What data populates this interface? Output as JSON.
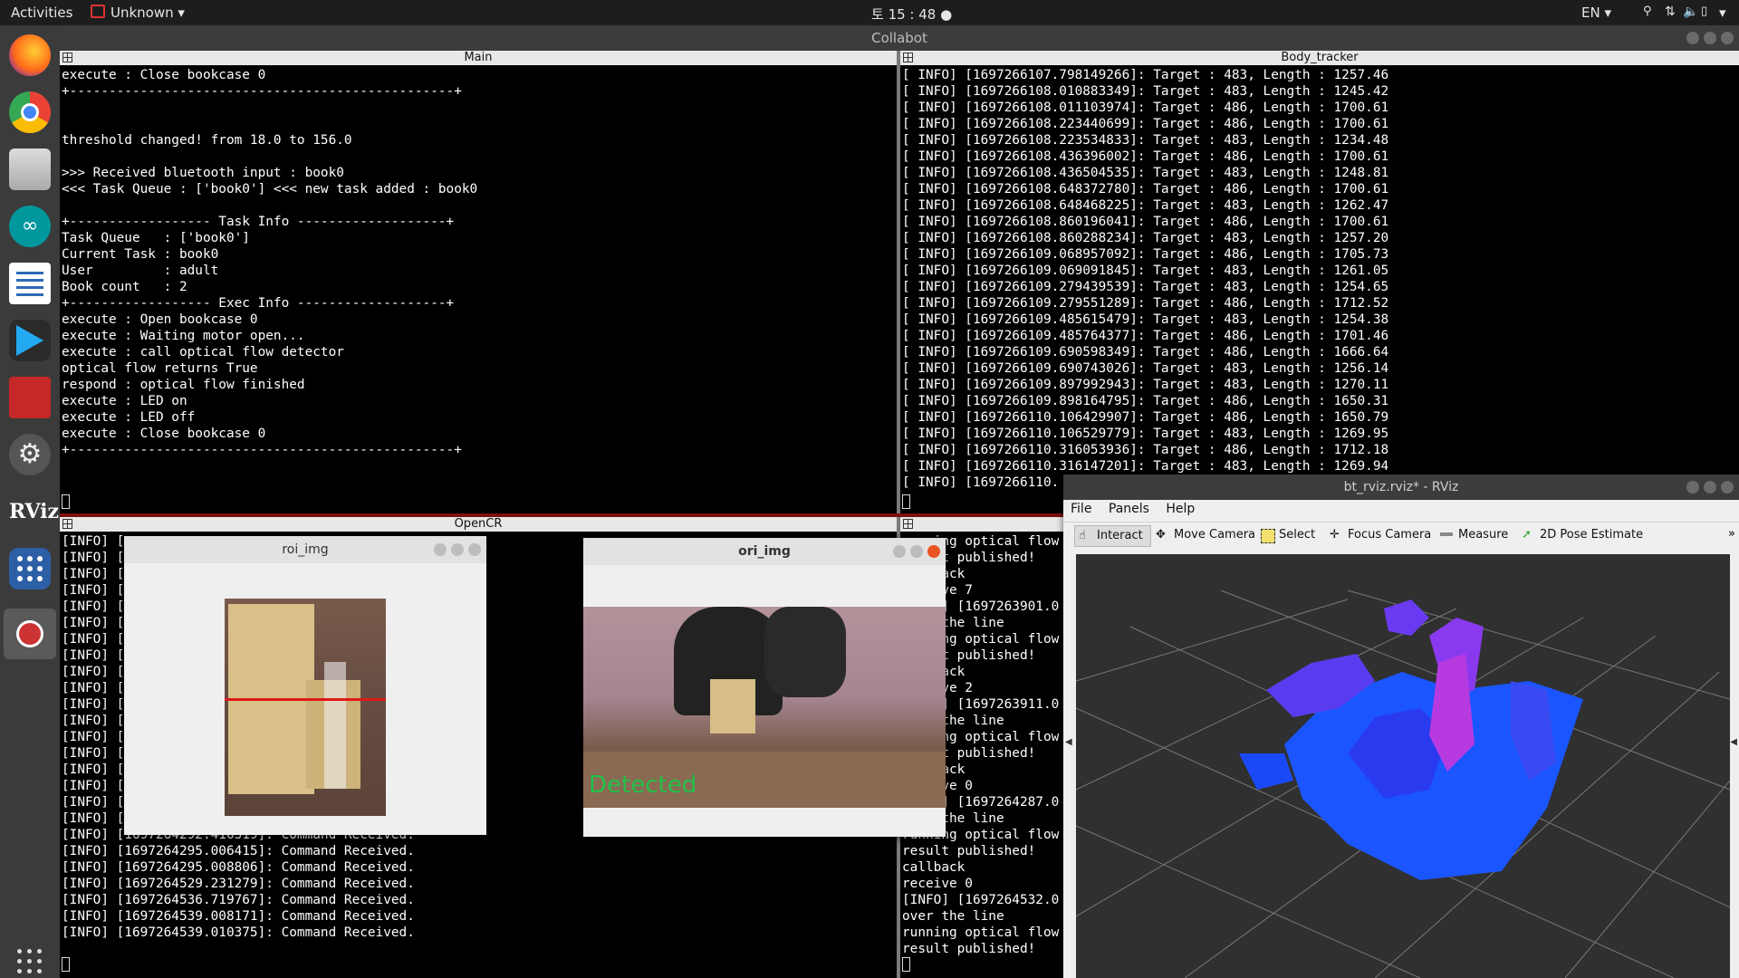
{
  "topbar": {
    "activities": "Activities",
    "app_menu": "Unknown",
    "clock": "토 15 : 48",
    "lang": "EN"
  },
  "terminator": {
    "title": "Collabot"
  },
  "dock": {
    "icons": [
      "firefox-icon",
      "chrome-icon",
      "files-icon",
      "arduino-icon",
      "text-editor-icon",
      "vscode-icon",
      "system-monitor-icon",
      "settings-icon",
      "rviz-icon",
      "app-grid-icon",
      "recorder-icon",
      "show-apps-icon"
    ],
    "rviz_label": "RViz"
  },
  "panes": {
    "main": {
      "title": "Main",
      "text": "execute : Close bookcase 0\n+-------------------------------------------------+\n\n\nthreshold changed! from 18.0 to 156.0\n\n>>> Received bluetooth input : book0\n<<< Task Queue : ['book0'] <<< new task added : book0\n\n+------------------ Task Info -------------------+\nTask Queue   : ['book0']\nCurrent Task : book0\nUser         : adult\nBook count   : 2\n+------------------ Exec Info -------------------+\nexecute : Open bookcase 0\nexecute : Waiting motor open...\nexecute : call optical flow detector\noptical flow returns True\nrespond : optical flow finished\nexecute : LED on\nexecute : LED off\nexecute : Close bookcase 0\n+-------------------------------------------------+"
    },
    "body_tracker": {
      "title": "Body_tracker",
      "text": "[ INFO] [1697266107.798149266]: Target : 483, Length : 1257.46\n[ INFO] [1697266108.010883349]: Target : 483, Length : 1245.42\n[ INFO] [1697266108.011103974]: Target : 486, Length : 1700.61\n[ INFO] [1697266108.223440699]: Target : 486, Length : 1700.61\n[ INFO] [1697266108.223534833]: Target : 483, Length : 1234.48\n[ INFO] [1697266108.436396002]: Target : 486, Length : 1700.61\n[ INFO] [1697266108.436504535]: Target : 483, Length : 1248.81\n[ INFO] [1697266108.648372780]: Target : 486, Length : 1700.61\n[ INFO] [1697266108.648468225]: Target : 483, Length : 1262.47\n[ INFO] [1697266108.860196041]: Target : 486, Length : 1700.61\n[ INFO] [1697266108.860288234]: Target : 483, Length : 1257.20\n[ INFO] [1697266109.068957092]: Target : 486, Length : 1705.73\n[ INFO] [1697266109.069091845]: Target : 483, Length : 1261.05\n[ INFO] [1697266109.279439539]: Target : 483, Length : 1254.65\n[ INFO] [1697266109.279551289]: Target : 486, Length : 1712.52\n[ INFO] [1697266109.485615479]: Target : 483, Length : 1254.38\n[ INFO] [1697266109.485764377]: Target : 486, Length : 1701.46\n[ INFO] [1697266109.690598349]: Target : 486, Length : 1666.64\n[ INFO] [1697266109.690743026]: Target : 483, Length : 1256.14\n[ INFO] [1697266109.897992943]: Target : 483, Length : 1270.11\n[ INFO] [1697266109.898164795]: Target : 486, Length : 1650.31\n[ INFO] [1697266110.106429907]: Target : 486, Length : 1650.79\n[ INFO] [1697266110.106529779]: Target : 483, Length : 1269.95\n[ INFO] [1697266110.316053936]: Target : 486, Length : 1712.18\n[ INFO] [1697266110.316147201]: Target : 483, Length : 1269.94\n[ INFO] [1697266110."
    },
    "opencr": {
      "title": "OpenCR",
      "text": "[INFO] [\n[INFO] [\n[INFO] [\n[INFO] [\n[INFO] [\n[INFO] [\n[INFO] [\n[INFO] [\n[INFO] [\n[INFO] [\n[INFO] [\n[INFO] [\n[INFO] [\n[INFO] [\n[INFO] [\n[INFO] [\n[INFO] [\n[INFO] [1697264284.655955]: Command Received.\n[INFO] [1697264292.416319]: Command Received.\n[INFO] [1697264295.006415]: Command Received.\n[INFO] [1697264295.008806]: Command Received.\n[INFO] [1697264529.231279]: Command Received.\n[INFO] [1697264536.719767]: Command Received.\n[INFO] [1697264539.008171]: Command Received.\n[INFO] [1697264539.010375]: Command Received."
    },
    "fourth": {
      "title": "",
      "text": "running optical flow\nresult published!\ncallback\nreceive 7\n[INFO] [1697263901.0\nover the line\nrunning optical flow\nresult published!\ncallback\nreceive 2\n[INFO] [1697263911.0\nover the line\nrunning optical flow\nresult published!\ncallback\nreceive 0\n[INFO] [1697264287.0\nover the line\nrunning optical flow\nresult published!\ncallback\nreceive 0\n[INFO] [1697264532.0\nover the line\nrunning optical flow\nresult published!"
    }
  },
  "roi_window": {
    "title": "roi_img"
  },
  "ori_window": {
    "title": "ori_img",
    "overlay_text": "Detected"
  },
  "rviz": {
    "title": "bt_rviz.rviz* - RViz",
    "menu": {
      "file": "File",
      "panels": "Panels",
      "help": "Help"
    },
    "toolbar": {
      "interact": "Interact",
      "move_camera": "Move Camera",
      "select": "Select",
      "focus_camera": "Focus Camera",
      "measure": "Measure",
      "pose_estimate": "2D Pose Estimate"
    }
  }
}
